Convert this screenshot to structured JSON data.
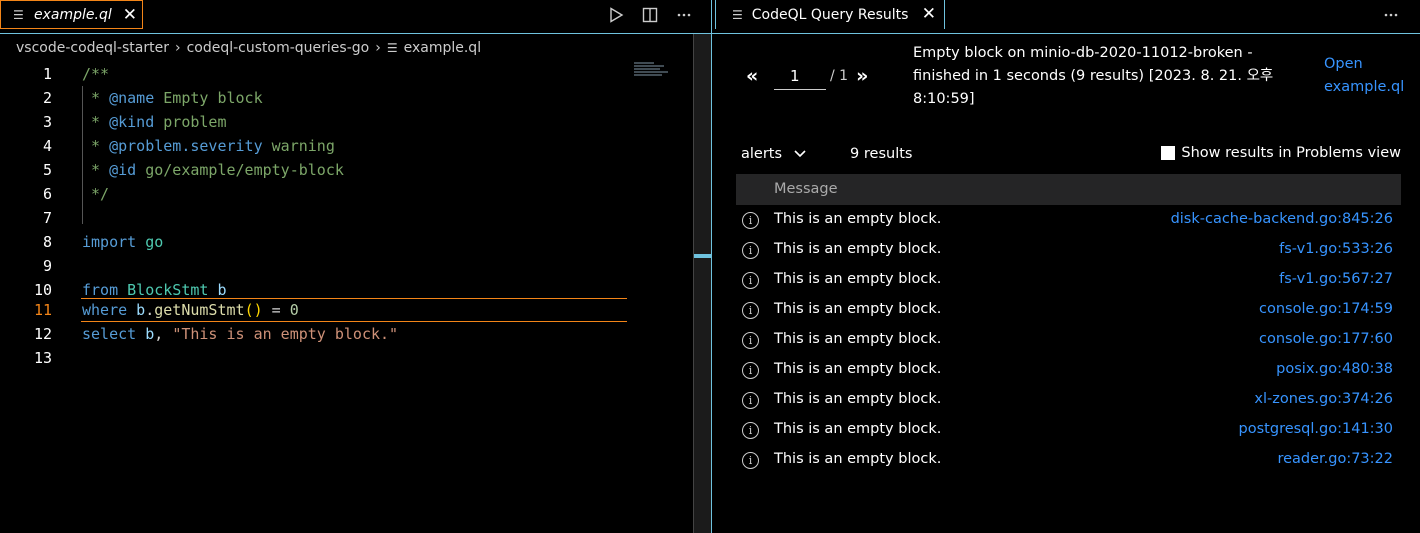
{
  "editor": {
    "tab": {
      "label": "example.ql",
      "icon": "file-lines-icon"
    },
    "actions": [
      "run-icon",
      "split-editor-icon",
      "more-actions-icon"
    ],
    "breadcrumb": [
      "vscode-codeql-starter",
      "codeql-custom-queries-go",
      "example.ql"
    ],
    "current_line": 11,
    "line_numbers": [
      "1",
      "2",
      "3",
      "4",
      "5",
      "6",
      "7",
      "8",
      "9",
      "10",
      "11",
      "12",
      "13"
    ]
  },
  "code": {
    "l1": "/**",
    "l2_star": " * ",
    "l2_tag": "@name",
    "l2_val": " Empty block",
    "l3_star": " * ",
    "l3_tag": "@kind",
    "l3_val": " problem",
    "l4_star": " * ",
    "l4_tag": "@problem.severity",
    "l4_val": " warning",
    "l5_star": " * ",
    "l5_tag": "@id",
    "l5_val": " go/example/empty-block",
    "l6": " */",
    "l8_kw": "import",
    "l8_mod": " go",
    "l10_kw": "from",
    "l10_type": " BlockStmt",
    "l10_var": " b",
    "l11_kw": "where",
    "l11_var": " b",
    "l11_dot": ".",
    "l11_fn": "getNumStmt",
    "l11_par": "()",
    "l11_op": " = ",
    "l11_num": "0",
    "l12_kw": "select",
    "l12_var": " b",
    "l12_comma": ", ",
    "l12_str": "\"This is an empty block.\""
  },
  "results": {
    "tab_label": "CodeQL Query Results",
    "page_input": "1",
    "page_total": "/ 1",
    "prev_label": "«",
    "next_label": "»",
    "query_info": "Empty block on minio-db-2020-11012-broken - finished in 1 seconds (9 results) [2023. 8. 21. 오후 8:10:59]",
    "open_link": "Open example.ql",
    "select_value": "alerts",
    "count": "9 results",
    "checkbox_label": "Show results in Problems view",
    "checkbox_checked": false,
    "column_header": "Message",
    "rows": [
      {
        "message": "This is an empty block.",
        "location": "disk-cache-backend.go:845:26"
      },
      {
        "message": "This is an empty block.",
        "location": "fs-v1.go:533:26"
      },
      {
        "message": "This is an empty block.",
        "location": "fs-v1.go:567:27"
      },
      {
        "message": "This is an empty block.",
        "location": "console.go:174:59"
      },
      {
        "message": "This is an empty block.",
        "location": "console.go:177:60"
      },
      {
        "message": "This is an empty block.",
        "location": "posix.go:480:38"
      },
      {
        "message": "This is an empty block.",
        "location": "xl-zones.go:374:26"
      },
      {
        "message": "This is an empty block.",
        "location": "postgresql.go:141:30"
      },
      {
        "message": "This is an empty block.",
        "location": "reader.go:73:22"
      }
    ]
  },
  "colors": {
    "accent_border": "#6fc3df",
    "active_outline": "#f38518",
    "link": "#3794ff"
  }
}
